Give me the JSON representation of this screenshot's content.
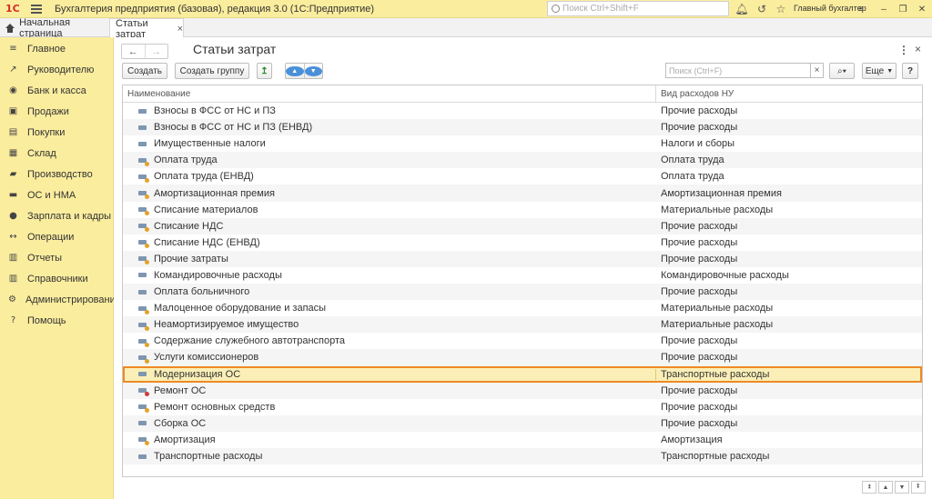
{
  "app": {
    "logo": "1С",
    "title": "Бухгалтерия предприятия (базовая), редакция 3.0  (1С:Предприятие)",
    "search_placeholder": "Поиск Ctrl+Shift+F",
    "user": "Главный бухгалтер"
  },
  "tabs": {
    "home": "Начальная страница",
    "active": "Статьи затрат"
  },
  "sidebar": {
    "items": [
      {
        "label": "Главное",
        "icon": "menu-icon"
      },
      {
        "label": "Руководителю",
        "icon": "trend-icon"
      },
      {
        "label": "Банк и касса",
        "icon": "coins-icon"
      },
      {
        "label": "Продажи",
        "icon": "bag-icon"
      },
      {
        "label": "Покупки",
        "icon": "cart-icon"
      },
      {
        "label": "Склад",
        "icon": "box-icon"
      },
      {
        "label": "Производство",
        "icon": "factory-icon"
      },
      {
        "label": "ОС и НМА",
        "icon": "truck-icon"
      },
      {
        "label": "Зарплата и кадры",
        "icon": "people-icon"
      },
      {
        "label": "Операции",
        "icon": "operations-icon"
      },
      {
        "label": "Отчеты",
        "icon": "chart-icon"
      },
      {
        "label": "Справочники",
        "icon": "books-icon"
      },
      {
        "label": "Администрирование",
        "icon": "gear-icon"
      },
      {
        "label": "Помощь",
        "icon": "help-icon"
      }
    ]
  },
  "page": {
    "title": "Статьи затрат",
    "toolbar": {
      "create": "Создать",
      "create_group": "Создать группу",
      "search_placeholder": "Поиск (Ctrl+F)",
      "more": "Еще",
      "help": "?"
    },
    "columns": {
      "name": "Наименование",
      "kind": "Вид расходов НУ"
    },
    "rows": [
      {
        "name": "Взносы в ФСС от НС и ПЗ",
        "kind": "Прочие расходы",
        "icon": "plain"
      },
      {
        "name": "Взносы в ФСС от НС и ПЗ (ЕНВД)",
        "kind": "Прочие расходы",
        "icon": "plain"
      },
      {
        "name": "Имущественные налоги",
        "kind": "Налоги и сборы",
        "icon": "plain"
      },
      {
        "name": "Оплата труда",
        "kind": "Оплата труда",
        "icon": "ch"
      },
      {
        "name": "Оплата труда (ЕНВД)",
        "kind": "Оплата труда",
        "icon": "ch"
      },
      {
        "name": "Амортизационная премия",
        "kind": "Амортизационная премия",
        "icon": "ch"
      },
      {
        "name": "Списание материалов",
        "kind": "Материальные расходы",
        "icon": "ch"
      },
      {
        "name": "Списание НДС",
        "kind": "Прочие расходы",
        "icon": "ch"
      },
      {
        "name": "Списание НДС (ЕНВД)",
        "kind": "Прочие расходы",
        "icon": "ch"
      },
      {
        "name": "Прочие затраты",
        "kind": "Прочие расходы",
        "icon": "ch"
      },
      {
        "name": "Командировочные расходы",
        "kind": "Командировочные расходы",
        "icon": "plain"
      },
      {
        "name": "Оплата больничного",
        "kind": "Прочие расходы",
        "icon": "plain"
      },
      {
        "name": "Малоценное оборудование и запасы",
        "kind": "Материальные расходы",
        "icon": "ch"
      },
      {
        "name": "Неамортизируемое имущество",
        "kind": "Материальные расходы",
        "icon": "ch"
      },
      {
        "name": "Содержание служебного автотранспорта",
        "kind": "Прочие расходы",
        "icon": "ch"
      },
      {
        "name": "Услуги комиссионеров",
        "kind": "Прочие расходы",
        "icon": "ch"
      },
      {
        "name": "Модернизация ОС",
        "kind": "Транспортные расходы",
        "icon": "plain",
        "selected": true
      },
      {
        "name": "Ремонт ОС",
        "kind": "Прочие расходы",
        "icon": "red"
      },
      {
        "name": "Ремонт основных средств",
        "kind": "Прочие расходы",
        "icon": "ch"
      },
      {
        "name": "Сборка ОС",
        "kind": "Прочие расходы",
        "icon": "plain"
      },
      {
        "name": "Амортизация",
        "kind": "Амортизация",
        "icon": "ch"
      },
      {
        "name": "Транспортные расходы",
        "kind": "Транспортные расходы",
        "icon": "plain"
      }
    ]
  }
}
